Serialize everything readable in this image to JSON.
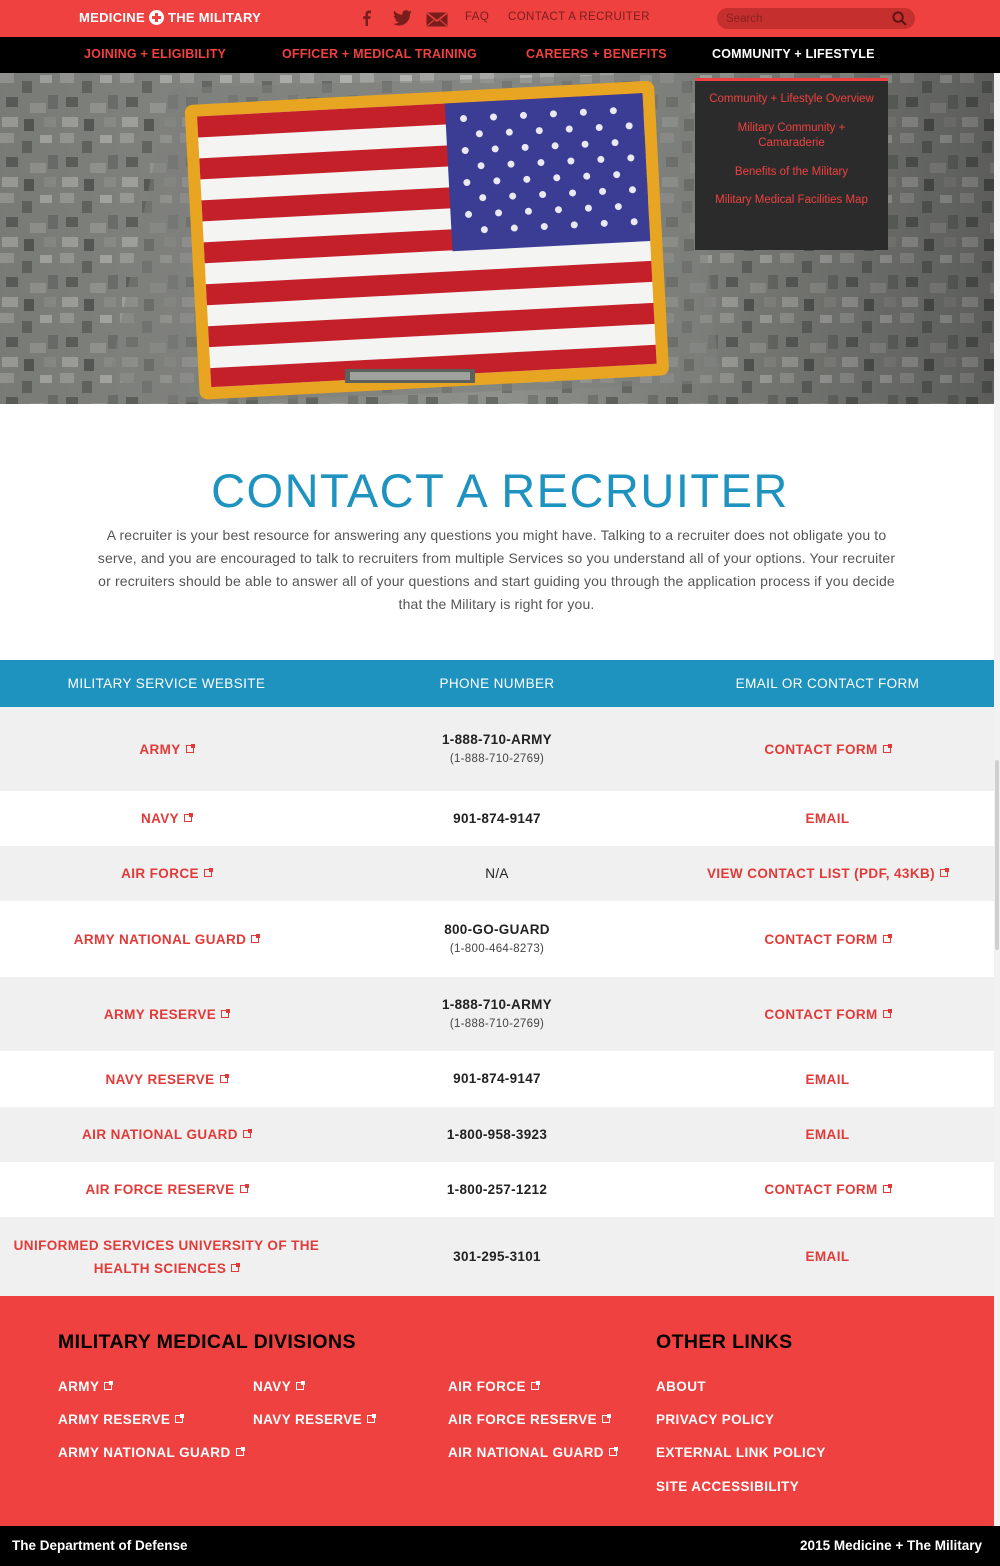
{
  "brand": {
    "logo_text_left": "MEDICINE",
    "logo_text_right": "THE MILITARY"
  },
  "topbar": {
    "icons": [
      "facebook-icon",
      "twitter-icon",
      "mail-icon"
    ],
    "faq_label": "FAQ",
    "contact_label": "CONTACT A RECRUITER",
    "search_placeholder": "Search"
  },
  "nav": {
    "items": [
      {
        "label": "JOINING + ELIGIBILITY"
      },
      {
        "label": "OFFICER + MEDICAL TRAINING"
      },
      {
        "label": "CAREERS + BENEFITS"
      },
      {
        "label": "COMMUNITY + LIFESTYLE",
        "active": true
      }
    ],
    "dropdown": [
      "Community + Lifestyle Overview",
      "Military Community + Camaraderie",
      "Benefits of the Military",
      "Military Medical Facilities Map"
    ]
  },
  "page": {
    "title": "CONTACT A RECRUITER",
    "intro": "A recruiter is your best resource for answering any questions you might have. Talking to a recruiter does not obligate you to serve, and you are encouraged to talk to recruiters from multiple Services so you understand all of your options. Your recruiter or recruiters should be able to answer all of your questions and start guiding you through the application process if you decide that the Military is right for you."
  },
  "table": {
    "headers": [
      "MILITARY SERVICE WEBSITE",
      "PHONE NUMBER",
      "EMAIL OR CONTACT FORM"
    ],
    "rows": [
      {
        "service": "ARMY",
        "phone": "1-888-710-ARMY",
        "phone_sub": "(1-888-710-2769)",
        "contact": "CONTACT FORM"
      },
      {
        "service": "NAVY",
        "phone": "901-874-9147",
        "phone_sub": "",
        "contact": "EMAIL"
      },
      {
        "service": "AIR FORCE",
        "phone": "N/A",
        "phone_sub": "",
        "contact": "VIEW CONTACT LIST (PDF, 43KB)"
      },
      {
        "service": "ARMY NATIONAL GUARD",
        "phone": "800-GO-GUARD",
        "phone_sub": "(1-800-464-8273)",
        "contact": "CONTACT FORM"
      },
      {
        "service": "ARMY RESERVE",
        "phone": "1-888-710-ARMY",
        "phone_sub": "(1-888-710-2769)",
        "contact": "CONTACT FORM"
      },
      {
        "service": "NAVY RESERVE",
        "phone": "901-874-9147",
        "phone_sub": "",
        "contact": "EMAIL"
      },
      {
        "service": "AIR NATIONAL GUARD",
        "phone": "1-800-958-3923",
        "phone_sub": "",
        "contact": "EMAIL"
      },
      {
        "service": "AIR FORCE RESERVE",
        "phone": "1-800-257-1212",
        "phone_sub": "",
        "contact": "CONTACT FORM"
      },
      {
        "service_line1": "UNIFORMED SERVICES UNIVERSITY OF THE",
        "service_line2": "HEALTH SCIENCES",
        "phone": "301-295-3101",
        "phone_sub": "",
        "contact": "EMAIL"
      }
    ]
  },
  "footer": {
    "divisions_heading": "MILITARY MEDICAL DIVISIONS",
    "divisions": [
      "ARMY",
      "NAVY",
      "AIR FORCE",
      "ARMY RESERVE",
      "NAVY RESERVE",
      "AIR FORCE RESERVE",
      "ARMY NATIONAL GUARD",
      "AIR NATIONAL GUARD"
    ],
    "other_heading": "OTHER LINKS",
    "other_links": [
      "ABOUT",
      "PRIVACY POLICY",
      "EXTERNAL LINK POLICY",
      "SITE ACCESSIBILITY"
    ],
    "bottom_left": "The Department of Defense",
    "bottom_right": "2015 Medicine + The Military"
  },
  "colors": {
    "brand_red": "#ee4140",
    "accent_blue": "#1f93bf",
    "black": "#000000",
    "row_gray": "#f0f0f0"
  }
}
